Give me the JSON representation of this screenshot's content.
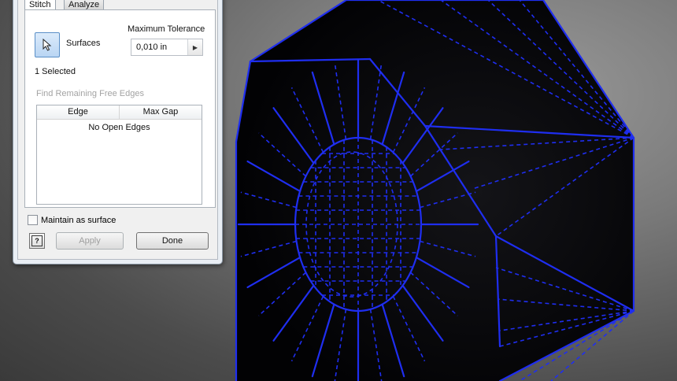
{
  "viewport": {
    "mesh_color": "#1f2ef0",
    "body_color": "#050508"
  },
  "dialog": {
    "tabs": [
      {
        "label": "Stitch",
        "active": true
      },
      {
        "label": "Analyze",
        "active": false
      }
    ],
    "surfaces_label": "Surfaces",
    "surfaces_icon": "cursor-arrow-icon",
    "max_tolerance_label": "Maximum Tolerance",
    "tolerance_value": "0,010 in",
    "selected_count": "1 Selected",
    "find_remaining_label": "Find Remaining Free Edges",
    "table": {
      "columns": [
        "Edge",
        "Max Gap"
      ],
      "empty_message": "No Open Edges"
    },
    "maintain_as_surface_label": "Maintain as surface",
    "maintain_as_surface_checked": false,
    "help_icon": "help-icon",
    "apply_label": "Apply",
    "done_label": "Done"
  }
}
